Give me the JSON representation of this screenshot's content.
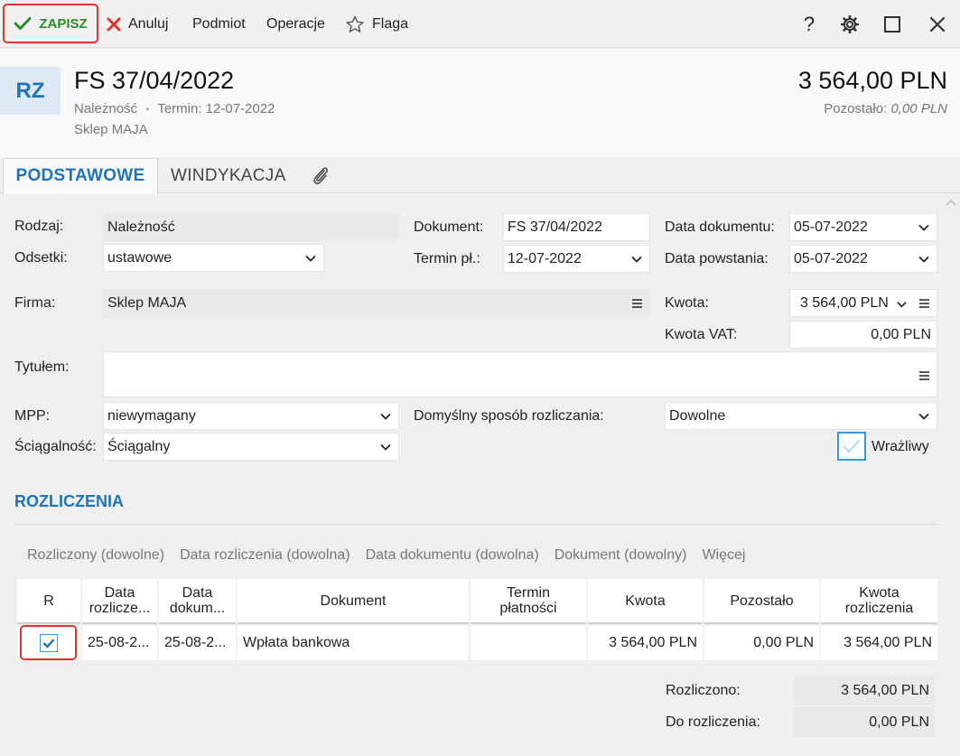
{
  "toolbar": {
    "save_label": "ZAPISZ",
    "cancel_label": "Anuluj",
    "subject_label": "Podmiot",
    "operations_label": "Operacje",
    "flag_label": "Flaga",
    "help_label": "?"
  },
  "header": {
    "avatar": "RZ",
    "title": "FS 37/04/2022",
    "type": "Należność",
    "separator": "•",
    "due": "Termin: 12-07-2022",
    "company": "Sklep MAJA",
    "amount": "3 564,00 PLN",
    "remaining_label": "Pozostało:",
    "remaining_value": "0,00 PLN"
  },
  "tabs": [
    {
      "label": "PODSTAWOWE",
      "active": true
    },
    {
      "label": "WINDYKACJA",
      "active": false
    }
  ],
  "form": {
    "rodzaj": {
      "label": "Rodzaj:",
      "value": "Należność"
    },
    "odsetki": {
      "label": "Odsetki:",
      "value": "ustawowe"
    },
    "firma": {
      "label": "Firma:",
      "value": "Sklep MAJA"
    },
    "tytulem": {
      "label": "Tytułem:",
      "value": ""
    },
    "mpp": {
      "label": "MPP:",
      "value": "niewymagany"
    },
    "sciagalnosc": {
      "label": "Ściągalność:",
      "value": "Ściągalny"
    },
    "dokument": {
      "label": "Dokument:",
      "value": "FS 37/04/2022"
    },
    "termin": {
      "label": "Termin pł.:",
      "value": "12-07-2022"
    },
    "sposob": {
      "label": "Domyślny sposób rozliczania:",
      "value": "Dowolne"
    },
    "data_dokumentu": {
      "label": "Data dokumentu:",
      "value": "05-07-2022"
    },
    "data_powstania": {
      "label": "Data powstania:",
      "value": "05-07-2022"
    },
    "kwota": {
      "label": "Kwota:",
      "value": "3 564,00 PLN"
    },
    "kwota_vat": {
      "label": "Kwota VAT:",
      "value": "0,00 PLN"
    },
    "wrazliwy": {
      "label": "Wrażliwy",
      "checked": true
    }
  },
  "settlements": {
    "title": "ROZLICZENIA",
    "filters": [
      "Rozliczony (dowolne)",
      "Data rozliczenia (dowolna)",
      "Data dokumentu (dowolna)",
      "Dokument (dowolny)",
      "Więcej"
    ],
    "columns": [
      {
        "line1": "R",
        "line2": ""
      },
      {
        "line1": "Data",
        "line2": "rozlicze..."
      },
      {
        "line1": "Data",
        "line2": "dokum..."
      },
      {
        "line1": "Dokument",
        "line2": ""
      },
      {
        "line1": "Termin",
        "line2": "płatności"
      },
      {
        "line1": "Kwota",
        "line2": ""
      },
      {
        "line1": "Pozostało",
        "line2": ""
      },
      {
        "line1": "Kwota",
        "line2": "rozliczenia"
      }
    ],
    "rows": [
      {
        "checked": true,
        "data_rozliczenia": "25-08-2...",
        "data_dokumentu": "25-08-2...",
        "dokument": "Wpłata bankowa",
        "termin": "",
        "kwota": "3 564,00 PLN",
        "pozostalo": "0,00 PLN",
        "kwota_rozliczenia": "3 564,00 PLN"
      }
    ],
    "rozliczono_label": "Rozliczono:",
    "rozliczono_value": "3 564,00 PLN",
    "do_rozliczenia_label": "Do rozliczenia:",
    "do_rozliczenia_value": "0,00 PLN"
  },
  "colors": {
    "accent": "#1d74b7",
    "save_green": "#2d8a2d",
    "highlight_red": "#e0322f",
    "cancel_red": "#e0322f"
  }
}
